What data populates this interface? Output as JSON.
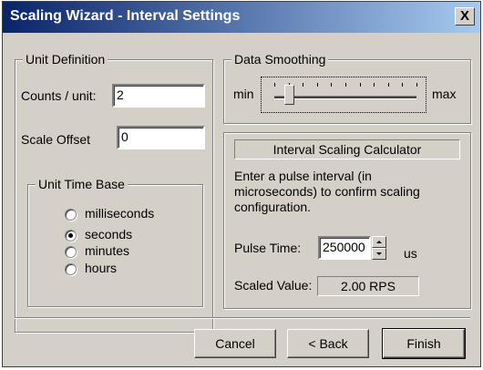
{
  "window": {
    "title": "Scaling Wizard - Interval Settings",
    "close_glyph": "X"
  },
  "unit_definition": {
    "legend": "Unit Definition",
    "counts_label": "Counts / unit:",
    "counts_value": "2",
    "offset_label": "Scale Offset",
    "offset_value": "0"
  },
  "time_base": {
    "legend": "Unit Time Base",
    "options": [
      {
        "label": "milliseconds",
        "selected": false
      },
      {
        "label": "seconds",
        "selected": true
      },
      {
        "label": "minutes",
        "selected": false
      },
      {
        "label": "hours",
        "selected": false
      }
    ]
  },
  "smoothing": {
    "legend": "Data Smoothing",
    "min_label": "min",
    "max_label": "max",
    "tick_count": 11,
    "level": 0.1
  },
  "calculator": {
    "title": "Interval Scaling Calculator",
    "instructions": "Enter a pulse interval (in microseconds) to confirm scaling configuration.",
    "pulse_label": "Pulse Time:",
    "pulse_value": "250000",
    "pulse_unit": "us",
    "scaled_label": "Scaled Value:",
    "scaled_value": "2.00 RPS"
  },
  "buttons": {
    "cancel": "Cancel",
    "back": "< Back",
    "finish": "Finish"
  },
  "icons": {
    "close": "close-icon",
    "spin_up": "spin-up-icon",
    "spin_down": "spin-down-icon"
  }
}
